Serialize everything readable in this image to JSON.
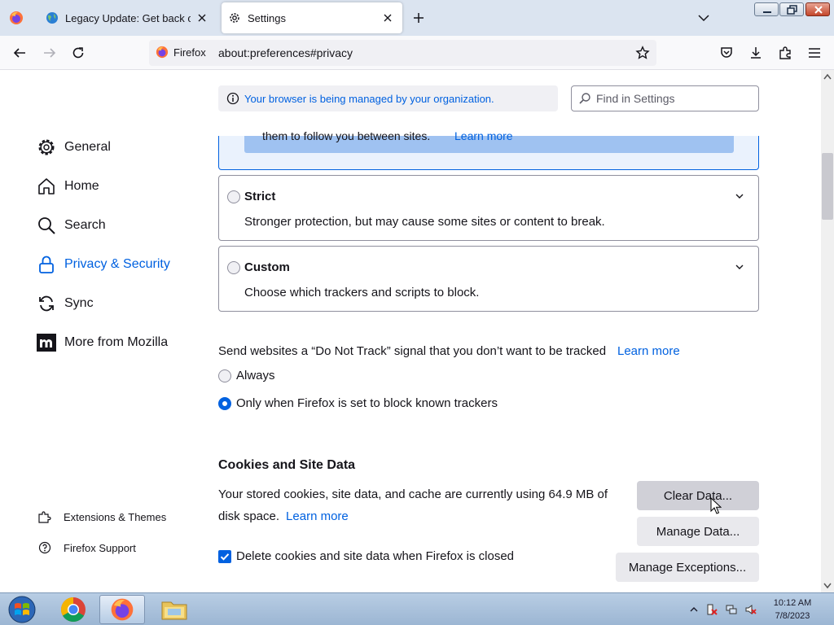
{
  "browser": {
    "tabs": [
      {
        "label": "Legacy Update: Get back online"
      },
      {
        "label": "Settings"
      }
    ],
    "url_identity": "Firefox",
    "url": "about:preferences#privacy"
  },
  "header": {
    "policy_notice": "Your browser is being managed by your organization.",
    "search_placeholder": "Find in Settings"
  },
  "sidebar": {
    "categories": [
      {
        "label": "General",
        "icon": "gear-icon"
      },
      {
        "label": "Home",
        "icon": "home-icon"
      },
      {
        "label": "Search",
        "icon": "search-icon"
      },
      {
        "label": "Privacy & Security",
        "icon": "lock-icon",
        "selected": true
      },
      {
        "label": "Sync",
        "icon": "sync-icon"
      },
      {
        "label": "More from Mozilla",
        "icon": "mozilla-icon"
      }
    ],
    "footer": [
      {
        "label": "Extensions & Themes",
        "icon": "puzzle-icon"
      },
      {
        "label": "Firefox Support",
        "icon": "help-icon"
      }
    ]
  },
  "tracking": {
    "standard_partial_text": "them to follow you between sites.",
    "standard_learn_more": "Learn more",
    "strict": {
      "title": "Strict",
      "description": "Stronger protection, but may cause some sites or content to break."
    },
    "custom": {
      "title": "Custom",
      "description": "Choose which trackers and scripts to block."
    }
  },
  "dnt": {
    "label": "Send websites a “Do Not Track” signal that you don’t want to be tracked",
    "learn_more": "Learn more",
    "options": [
      {
        "label": "Always",
        "selected": false
      },
      {
        "label": "Only when Firefox is set to block known trackers",
        "selected": true
      }
    ]
  },
  "cookies": {
    "heading": "Cookies and Site Data",
    "description": "Your stored cookies, site data, and cache are currently using 64.9 MB of disk space.",
    "learn_more": "Learn more",
    "clear_data": "Clear Data...",
    "manage_data": "Manage Data...",
    "manage_exceptions": "Manage Exceptions...",
    "delete_on_close": "Delete cookies and site data when Firefox is closed",
    "delete_on_close_checked": true
  },
  "taskbar": {
    "time": "10:12 AM",
    "date": "7/8/2023"
  },
  "colors": {
    "accent": "#0061e0",
    "text": "#15141a",
    "tabbar": "#dbe4f0"
  }
}
